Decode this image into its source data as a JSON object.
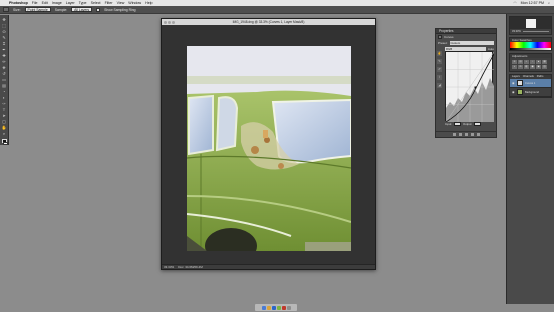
{
  "menubar": {
    "app_name": "Photoshop",
    "items": [
      "File",
      "Edit",
      "Image",
      "Layer",
      "Type",
      "Select",
      "Filter",
      "View",
      "Window",
      "Help"
    ],
    "clock": "Mon 12:57 PM"
  },
  "options_bar": {
    "size_label": "Size:",
    "size_value": "Point Sample",
    "sample_label": "Sample:",
    "sample_value": "All Layers",
    "show_sampling_ring": "Show Sampling Ring"
  },
  "toolbar": {
    "tools": [
      "move-icon",
      "marquee-icon",
      "lasso-icon",
      "quick-select-icon",
      "crop-icon",
      "eyedropper-icon",
      "healing-icon",
      "brush-icon",
      "clone-stamp-icon",
      "history-brush-icon",
      "eraser-icon",
      "gradient-icon",
      "blur-icon",
      "dodge-icon",
      "pen-icon",
      "type-icon",
      "path-select-icon",
      "rectangle-icon",
      "hand-icon",
      "zoom-icon"
    ],
    "glyphs": [
      "✥",
      "⬚",
      "ʘ",
      "✎",
      "⌗",
      "✒",
      "✚",
      "✏",
      "⎈",
      "↺",
      "▭",
      "▤",
      "◔",
      "◐",
      "✑",
      "T",
      "➤",
      "▢",
      "✋",
      "⌕"
    ]
  },
  "document": {
    "title": "IMG_1948.dng @ 33.3% (Curves 1, Layer Mask/8)",
    "status_zoom": "33.33%",
    "status_doc": "Doc: 34.6M/69.4M"
  },
  "properties": {
    "tab_label": "Properties",
    "adjustment_label": "Curves",
    "preset_label": "Preset:",
    "preset_value": "Custom",
    "channel_value": "RGB",
    "auto_label": "Auto",
    "input_label": "Input:",
    "output_label": "Output:",
    "left_tool_glyphs": [
      "☝",
      "✎",
      "✐",
      "⌇",
      "◢"
    ]
  },
  "dock": {
    "navigator_zoom": "33.33%",
    "color_tab": "Color",
    "swatches_tab": "Swatches",
    "adjustments_tab": "Adjustments",
    "layers_tabs": [
      "Layers",
      "Channels",
      "Paths"
    ],
    "adj_icons": [
      "☀",
      "▤",
      "◐",
      "≈",
      "▲",
      "▦",
      "◑",
      "⚖",
      "◧",
      "◼",
      "▣",
      "▨"
    ],
    "layers": [
      {
        "name": "Curves 1",
        "active": true
      },
      {
        "name": "Background",
        "active": false
      }
    ]
  },
  "colors": {
    "car_green": "#8fb04f",
    "sky": "#e3e4ec",
    "workspace": "#8c8c8c"
  }
}
